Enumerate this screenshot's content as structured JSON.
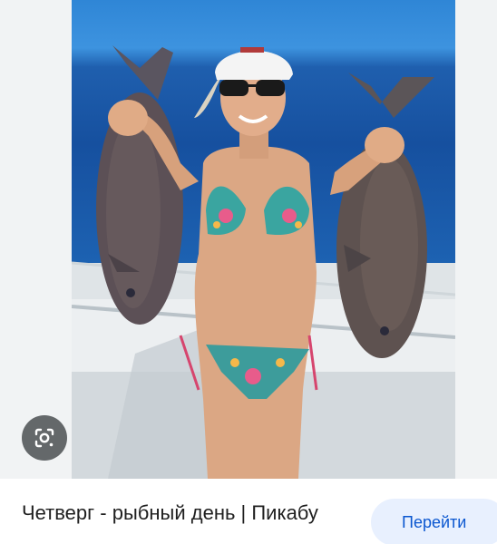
{
  "result": {
    "title": "Четверг - рыбный день | Пикабу",
    "go_button_label": "Перейти"
  },
  "image": {
    "alt": "Женщина на лодке держит двух рыб",
    "lens_icon": "google-lens-icon"
  },
  "colors": {
    "button_bg": "#e8f0fe",
    "button_text": "#0b57d0",
    "lens_bg": "#3c4043"
  }
}
